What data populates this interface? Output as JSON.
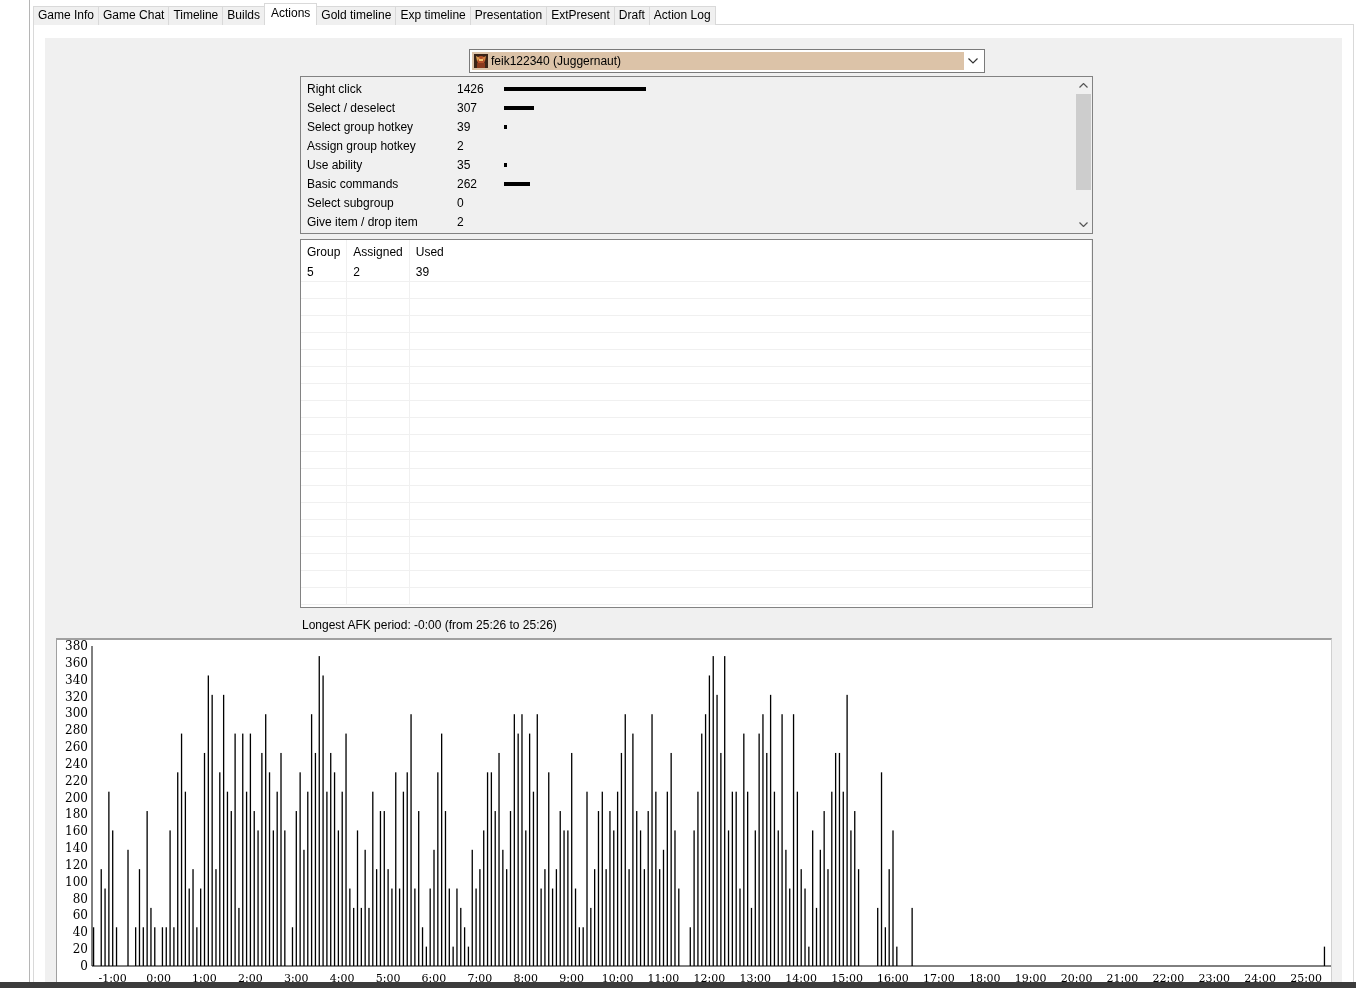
{
  "tabs": [
    {
      "label": "Game Info",
      "selected": false
    },
    {
      "label": "Game Chat",
      "selected": false
    },
    {
      "label": "Timeline",
      "selected": false
    },
    {
      "label": "Builds",
      "selected": false
    },
    {
      "label": "Actions",
      "selected": true
    },
    {
      "label": "Gold timeline",
      "selected": false
    },
    {
      "label": "Exp timeline",
      "selected": false
    },
    {
      "label": "Presentation",
      "selected": false
    },
    {
      "label": "ExtPresent",
      "selected": false
    },
    {
      "label": "Draft",
      "selected": false
    },
    {
      "label": "Action Log",
      "selected": false
    }
  ],
  "player_select": {
    "value": "feik122340 (Juggernaut)"
  },
  "actions": [
    {
      "name": "Right click",
      "count": "1426"
    },
    {
      "name": "Select / deselect",
      "count": "307"
    },
    {
      "name": "Select group hotkey",
      "count": "39"
    },
    {
      "name": "Assign group hotkey",
      "count": "2"
    },
    {
      "name": "Use ability",
      "count": "35"
    },
    {
      "name": "Basic commands",
      "count": "262"
    },
    {
      "name": "Select subgroup",
      "count": "0"
    },
    {
      "name": "Give item / drop item",
      "count": "2"
    }
  ],
  "groups_table": {
    "columns": [
      "Group",
      "Assigned",
      "Used"
    ],
    "rows": [
      [
        "5",
        "2",
        "39"
      ]
    ]
  },
  "afk_text": "Longest AFK period: -0:00 (from 25:26 to 25:26)",
  "chart_data": {
    "type": "bar",
    "ylim": [
      0,
      380
    ],
    "xlim": [
      -87,
      1530
    ],
    "yticks": [
      0,
      20,
      40,
      60,
      80,
      100,
      120,
      140,
      160,
      180,
      200,
      220,
      240,
      260,
      280,
      300,
      320,
      340,
      360,
      380
    ],
    "xticks": [
      {
        "value": -60,
        "label": "-1:00"
      },
      {
        "value": 0,
        "label": "0:00"
      },
      {
        "value": 60,
        "label": "1:00"
      },
      {
        "value": 120,
        "label": "2:00"
      },
      {
        "value": 180,
        "label": "3:00"
      },
      {
        "value": 240,
        "label": "4:00"
      },
      {
        "value": 300,
        "label": "5:00"
      },
      {
        "value": 360,
        "label": "6:00"
      },
      {
        "value": 420,
        "label": "7:00"
      },
      {
        "value": 480,
        "label": "8:00"
      },
      {
        "value": 540,
        "label": "9:00"
      },
      {
        "value": 600,
        "label": "10:00"
      },
      {
        "value": 660,
        "label": "11:00"
      },
      {
        "value": 720,
        "label": "12:00"
      },
      {
        "value": 780,
        "label": "13:00"
      },
      {
        "value": 840,
        "label": "14:00"
      },
      {
        "value": 900,
        "label": "15:00"
      },
      {
        "value": 960,
        "label": "16:00"
      },
      {
        "value": 1020,
        "label": "17:00"
      },
      {
        "value": 1080,
        "label": "18:00"
      },
      {
        "value": 1140,
        "label": "19:00"
      },
      {
        "value": 1200,
        "label": "20:00"
      },
      {
        "value": 1260,
        "label": "21:00"
      },
      {
        "value": 1320,
        "label": "22:00"
      },
      {
        "value": 1380,
        "label": "23:00"
      },
      {
        "value": 1440,
        "label": "24:00"
      },
      {
        "value": 1500,
        "label": "25:00"
      }
    ],
    "x": [
      -85,
      -75,
      -70,
      -65,
      -60,
      -55,
      -40,
      -30,
      -25,
      -20,
      -15,
      -10,
      -5,
      5,
      10,
      15,
      20,
      25,
      30,
      35,
      40,
      45,
      50,
      55,
      60,
      65,
      70,
      75,
      80,
      85,
      90,
      95,
      100,
      105,
      110,
      115,
      120,
      125,
      130,
      135,
      140,
      145,
      150,
      155,
      160,
      165,
      175,
      180,
      185,
      190,
      195,
      200,
      205,
      210,
      215,
      220,
      225,
      230,
      235,
      240,
      245,
      250,
      255,
      260,
      265,
      270,
      275,
      280,
      285,
      290,
      295,
      300,
      305,
      310,
      315,
      320,
      325,
      330,
      335,
      340,
      345,
      350,
      355,
      360,
      365,
      370,
      375,
      380,
      385,
      390,
      395,
      400,
      405,
      410,
      415,
      420,
      425,
      430,
      435,
      440,
      445,
      450,
      455,
      460,
      465,
      470,
      475,
      480,
      485,
      490,
      495,
      500,
      505,
      510,
      515,
      520,
      525,
      530,
      535,
      540,
      545,
      550,
      555,
      560,
      565,
      570,
      575,
      580,
      585,
      590,
      595,
      600,
      605,
      610,
      615,
      620,
      625,
      630,
      635,
      640,
      645,
      650,
      655,
      660,
      665,
      670,
      675,
      680,
      695,
      700,
      705,
      710,
      715,
      720,
      725,
      730,
      735,
      740,
      745,
      750,
      755,
      760,
      765,
      770,
      775,
      780,
      785,
      790,
      795,
      800,
      805,
      810,
      815,
      820,
      825,
      830,
      835,
      840,
      845,
      850,
      855,
      860,
      865,
      870,
      875,
      880,
      885,
      890,
      895,
      900,
      905,
      910,
      915,
      940,
      945,
      950,
      955,
      960,
      965,
      985,
      1524
    ],
    "series": [
      {
        "color": "#000000",
        "values": [
          46,
          115,
          92,
          207,
          161,
          46,
          138,
          46,
          115,
          46,
          184,
          69,
          46,
          46,
          46,
          161,
          46,
          230,
          276,
          207,
          92,
          115,
          46,
          92,
          253,
          345,
          322,
          115,
          230,
          322,
          207,
          184,
          276,
          69,
          276,
          207,
          276,
          184,
          161,
          253,
          299,
          230,
          161,
          207,
          253,
          161,
          46,
          184,
          230,
          138,
          207,
          299,
          253,
          368,
          345,
          207,
          253,
          230,
          161,
          207,
          276,
          92,
          69,
          161,
          69,
          138,
          69,
          207,
          115,
          184,
          184,
          115,
          92,
          230,
          92,
          207,
          230,
          299,
          92,
          184,
          46,
          23,
          92,
          138,
          230,
          276,
          184,
          92,
          23,
          92,
          69,
          46,
          23,
          138,
          92,
          115,
          161,
          230,
          230,
          184,
          253,
          138,
          115,
          184,
          299,
          276,
          299,
          161,
          276,
          207,
          299,
          92,
          115,
          230,
          92,
          115,
          184,
          161,
          161,
          253,
          92,
          46,
          46,
          207,
          69,
          115,
          184,
          207,
          115,
          184,
          161,
          207,
          253,
          299,
          115,
          276,
          184,
          161,
          115,
          184,
          299,
          207,
          115,
          138,
          207,
          253,
          161,
          92,
          46,
          161,
          207,
          276,
          299,
          345,
          368,
          322,
          253,
          368,
          161,
          207,
          207,
          92,
          276,
          207,
          69,
          161,
          276,
          299,
          253,
          322,
          207,
          161,
          299,
          138,
          92,
          299,
          207,
          115,
          92,
          23,
          161,
          69,
          138,
          184,
          115,
          207,
          253,
          253,
          207,
          322,
          161,
          184,
          115,
          69,
          230,
          46,
          115,
          161,
          23,
          69,
          23
        ]
      }
    ]
  }
}
